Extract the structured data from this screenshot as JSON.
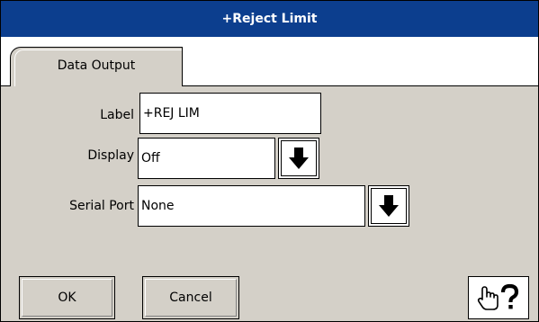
{
  "window": {
    "title": "+Reject Limit"
  },
  "tabs": [
    {
      "label": "Data Output",
      "selected": true
    }
  ],
  "form": {
    "label_field": {
      "label": "Label",
      "value": "+REJ LIM"
    },
    "display_field": {
      "label": "Display",
      "value": "Off"
    },
    "serial_port_field": {
      "label": "Serial Port",
      "value": "None"
    }
  },
  "buttons": {
    "ok_label": "OK",
    "cancel_label": "Cancel",
    "help_icon": "hand-question-icon",
    "dropdown_icon": "arrow-down-icon"
  },
  "colors": {
    "titlebar": "#0c3e8e",
    "panel": "#d4d0c8",
    "field": "#ffffff"
  }
}
